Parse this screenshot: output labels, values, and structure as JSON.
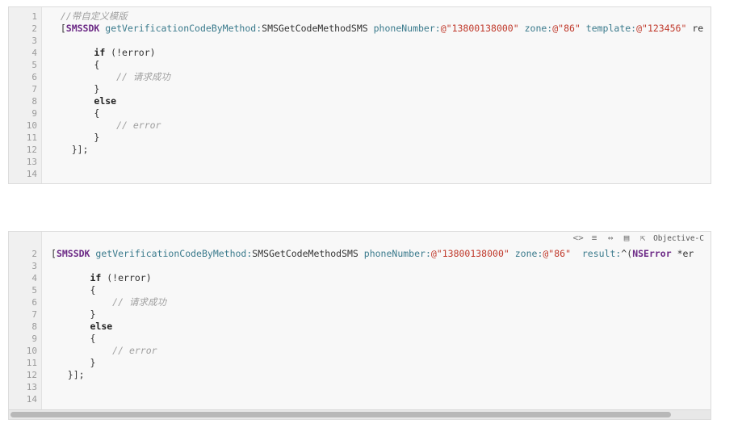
{
  "block1": {
    "lines": [
      {
        "n": "1",
        "parts": [
          {
            "c": "t-comment",
            "t": "  //带自定义模版"
          }
        ]
      },
      {
        "n": "2",
        "parts": [
          {
            "c": "t-plain",
            "t": "  ["
          },
          {
            "c": "t-class",
            "t": "SMSSDK"
          },
          {
            "c": "t-plain",
            "t": " "
          },
          {
            "c": "t-method",
            "t": "getVerificationCodeByMethod:"
          },
          {
            "c": "t-plain",
            "t": "SMSGetCodeMethodSMS "
          },
          {
            "c": "t-method",
            "t": "phoneNumber:"
          },
          {
            "c": "t-str",
            "t": "@\"13800138000\""
          },
          {
            "c": "t-plain",
            "t": " "
          },
          {
            "c": "t-method",
            "t": "zone:"
          },
          {
            "c": "t-str",
            "t": "@\"86\""
          },
          {
            "c": "t-plain",
            "t": " "
          },
          {
            "c": "t-method",
            "t": "template:"
          },
          {
            "c": "t-str",
            "t": "@\"123456\""
          },
          {
            "c": "t-plain",
            "t": " re"
          }
        ]
      },
      {
        "n": "3",
        "parts": []
      },
      {
        "n": "4",
        "parts": [
          {
            "c": "t-plain",
            "t": "        "
          },
          {
            "c": "t-kw",
            "t": "if"
          },
          {
            "c": "t-plain",
            "t": " (!error)"
          }
        ]
      },
      {
        "n": "5",
        "parts": [
          {
            "c": "t-plain",
            "t": "        {"
          }
        ]
      },
      {
        "n": "6",
        "parts": [
          {
            "c": "t-plain",
            "t": "            "
          },
          {
            "c": "t-comment",
            "t": "// 请求成功"
          }
        ]
      },
      {
        "n": "7",
        "parts": [
          {
            "c": "t-plain",
            "t": "        }"
          }
        ]
      },
      {
        "n": "8",
        "parts": [
          {
            "c": "t-plain",
            "t": "        "
          },
          {
            "c": "t-kw",
            "t": "else"
          }
        ]
      },
      {
        "n": "9",
        "parts": [
          {
            "c": "t-plain",
            "t": "        {"
          }
        ]
      },
      {
        "n": "10",
        "parts": [
          {
            "c": "t-plain",
            "t": "            "
          },
          {
            "c": "t-comment",
            "t": "// error"
          }
        ]
      },
      {
        "n": "11",
        "parts": [
          {
            "c": "t-plain",
            "t": "        }"
          }
        ]
      },
      {
        "n": "12",
        "parts": [
          {
            "c": "t-plain",
            "t": "    }];"
          }
        ]
      },
      {
        "n": "13",
        "parts": []
      },
      {
        "n": "14",
        "parts": []
      }
    ]
  },
  "block2": {
    "toolbar": {
      "icons": [
        "view-source-icon",
        "wrap-lines-icon",
        "expand-icon",
        "copy-icon",
        "popup-icon"
      ],
      "glyphs": [
        "<>",
        "≡",
        "↔",
        "▤",
        "⇱"
      ],
      "language": "Objective-C"
    },
    "lines": [
      {
        "n": "2",
        "parts": [
          {
            "c": "t-plain",
            "t": "["
          },
          {
            "c": "t-class",
            "t": "SMSSDK"
          },
          {
            "c": "t-plain",
            "t": " "
          },
          {
            "c": "t-method",
            "t": "getVerificationCodeByMethod:"
          },
          {
            "c": "t-plain",
            "t": "SMSGetCodeMethodSMS "
          },
          {
            "c": "t-method",
            "t": "phoneNumber:"
          },
          {
            "c": "t-str",
            "t": "@\"13800138000\""
          },
          {
            "c": "t-plain",
            "t": " "
          },
          {
            "c": "t-method",
            "t": "zone:"
          },
          {
            "c": "t-str",
            "t": "@\"86\""
          },
          {
            "c": "t-plain",
            "t": "  "
          },
          {
            "c": "t-method",
            "t": "result:"
          },
          {
            "c": "t-plain",
            "t": "^("
          },
          {
            "c": "t-class",
            "t": "NSError"
          },
          {
            "c": "t-plain",
            "t": " *er"
          }
        ]
      },
      {
        "n": "3",
        "parts": []
      },
      {
        "n": "4",
        "parts": [
          {
            "c": "t-plain",
            "t": "       "
          },
          {
            "c": "t-kw",
            "t": "if"
          },
          {
            "c": "t-plain",
            "t": " (!error)"
          }
        ]
      },
      {
        "n": "5",
        "parts": [
          {
            "c": "t-plain",
            "t": "       {"
          }
        ]
      },
      {
        "n": "6",
        "parts": [
          {
            "c": "t-plain",
            "t": "           "
          },
          {
            "c": "t-comment",
            "t": "// 请求成功"
          }
        ]
      },
      {
        "n": "7",
        "parts": [
          {
            "c": "t-plain",
            "t": "       }"
          }
        ]
      },
      {
        "n": "8",
        "parts": [
          {
            "c": "t-plain",
            "t": "       "
          },
          {
            "c": "t-kw",
            "t": "else"
          }
        ]
      },
      {
        "n": "9",
        "parts": [
          {
            "c": "t-plain",
            "t": "       {"
          }
        ]
      },
      {
        "n": "10",
        "parts": [
          {
            "c": "t-plain",
            "t": "           "
          },
          {
            "c": "t-comment",
            "t": "// error"
          }
        ]
      },
      {
        "n": "11",
        "parts": [
          {
            "c": "t-plain",
            "t": "       }"
          }
        ]
      },
      {
        "n": "12",
        "parts": [
          {
            "c": "t-plain",
            "t": "   }];"
          }
        ]
      },
      {
        "n": "13",
        "parts": []
      },
      {
        "n": "14",
        "parts": []
      }
    ]
  }
}
